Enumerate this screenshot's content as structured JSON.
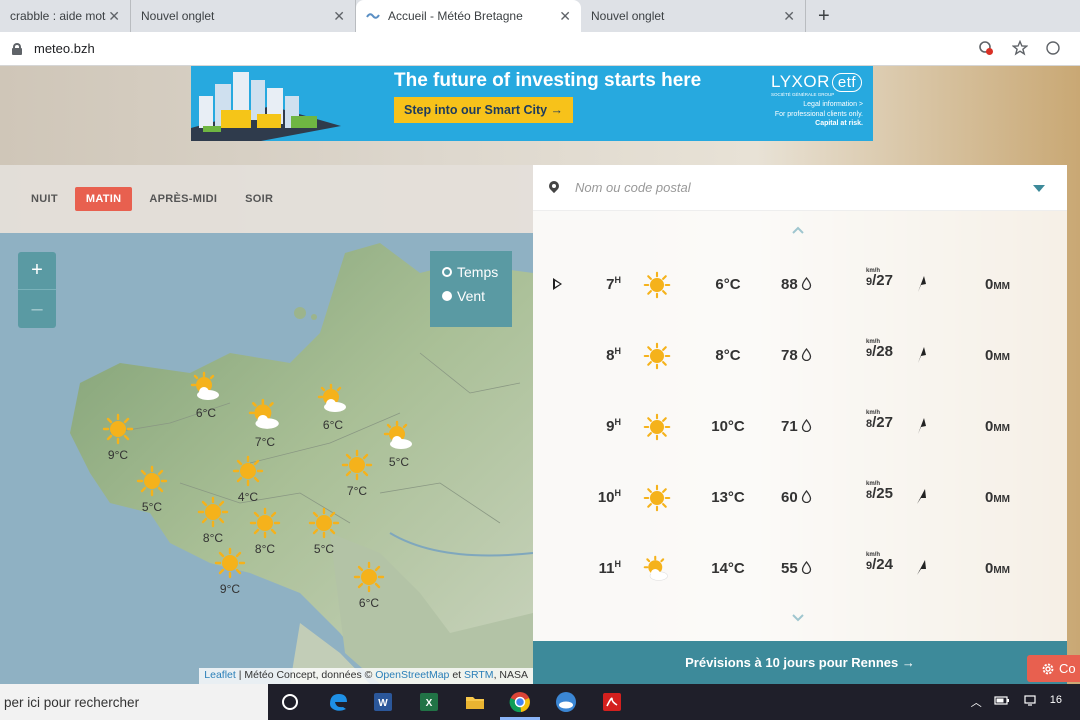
{
  "browser": {
    "tabs": [
      {
        "title": "crabble : aide mots et",
        "active": false
      },
      {
        "title": "Nouvel onglet",
        "active": false
      },
      {
        "title": "Accueil - Météo Bretagne",
        "active": true
      },
      {
        "title": "Nouvel onglet",
        "active": false
      }
    ],
    "close_glyph": "✕",
    "new_tab_glyph": "+",
    "url": "meteo.bzh"
  },
  "ad": {
    "headline": "The future of investing starts here",
    "cta": "Step into our Smart City →",
    "brand": "LYXOR",
    "brand_suffix": "etf",
    "brand_sub": "SOCIÉTÉ GÉNÉRALE GROUP",
    "legal_line1": "Legal information >",
    "legal_line2": "For professional clients only.",
    "legal_line3": "Capital at risk."
  },
  "periods": [
    {
      "label": "NUIT",
      "active": false
    },
    {
      "label": "MATIN",
      "active": true
    },
    {
      "label": "APRÈS-MIDI",
      "active": false
    },
    {
      "label": "SOIR",
      "active": false
    }
  ],
  "map": {
    "zoom_in": "+",
    "zoom_out": "–",
    "layers": [
      {
        "label": "Temps",
        "selected": true
      },
      {
        "label": "Vent",
        "selected": false
      }
    ],
    "markers": [
      {
        "temp": "9°C",
        "icon": "sun"
      },
      {
        "temp": "6°C",
        "icon": "sun-cloud"
      },
      {
        "temp": "7°C",
        "icon": "sun-cloud"
      },
      {
        "temp": "6°C",
        "icon": "sun-cloud"
      },
      {
        "temp": "5°C",
        "icon": "sun-cloud"
      },
      {
        "temp": "5°C",
        "icon": "sun"
      },
      {
        "temp": "4°C",
        "icon": "sun"
      },
      {
        "temp": "7°C",
        "icon": "sun"
      },
      {
        "temp": "8°C",
        "icon": "sun"
      },
      {
        "temp": "8°C",
        "icon": "sun"
      },
      {
        "temp": "5°C",
        "icon": "sun"
      },
      {
        "temp": "9°C",
        "icon": "sun"
      },
      {
        "temp": "6°C",
        "icon": "sun"
      }
    ],
    "attribution": {
      "leaflet": "Leaflet",
      "sep": " | Météo Concept, données © ",
      "osm": "OpenStreetMap",
      "and": " et ",
      "srtm": "SRTM",
      "tail": ", NASA"
    }
  },
  "forecast": {
    "search_placeholder": "Nom ou code postal",
    "wind_unit": "km/h",
    "rain_unit": "MM",
    "rows": [
      {
        "hour": "7",
        "hour_unit": "H",
        "icon": "sun",
        "temp": "6°C",
        "humidity": "88",
        "wind_mean": "9",
        "wind_gust": "/27",
        "rain": "0",
        "current": true
      },
      {
        "hour": "8",
        "hour_unit": "H",
        "icon": "sun",
        "temp": "8°C",
        "humidity": "78",
        "wind_mean": "9",
        "wind_gust": "/28",
        "rain": "0",
        "current": false
      },
      {
        "hour": "9",
        "hour_unit": "H",
        "icon": "sun",
        "temp": "10°C",
        "humidity": "71",
        "wind_mean": "8",
        "wind_gust": "/27",
        "rain": "0",
        "current": false
      },
      {
        "hour": "10",
        "hour_unit": "H",
        "icon": "sun",
        "temp": "13°C",
        "humidity": "60",
        "wind_mean": "8",
        "wind_gust": "/25",
        "rain": "0",
        "current": false
      },
      {
        "hour": "11",
        "hour_unit": "H",
        "icon": "sun-cloud",
        "temp": "14°C",
        "humidity": "55",
        "wind_mean": "9",
        "wind_gust": "/24",
        "rain": "0",
        "current": false
      }
    ],
    "cta": "Prévisions à 10 jours pour Rennes →"
  },
  "cookie_button": "Co",
  "taskbar": {
    "search": "per ici pour rechercher",
    "clock": "16"
  },
  "colors": {
    "accent": "#e8604f",
    "teal": "#3d8a9a",
    "sun": "#f5b21b"
  }
}
